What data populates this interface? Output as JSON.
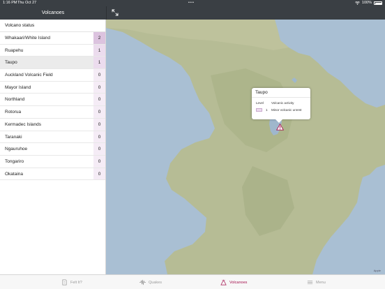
{
  "status_bar": {
    "time": "1:16 PM",
    "date": "Thu Oct 27",
    "dots": "•••",
    "battery": "100%"
  },
  "sidebar": {
    "title": "Volcanoes",
    "list_header": "Volcano status",
    "items": [
      {
        "name": "Whakaari/White Island",
        "level": "2"
      },
      {
        "name": "Ruapehu",
        "level": "1"
      },
      {
        "name": "Taupo",
        "level": "1"
      },
      {
        "name": "Auckland Volcanic Field",
        "level": "0"
      },
      {
        "name": "Mayor Island",
        "level": "0"
      },
      {
        "name": "Northland",
        "level": "0"
      },
      {
        "name": "Rotorua",
        "level": "0"
      },
      {
        "name": "Kermadec Islands",
        "level": "0"
      },
      {
        "name": "Taranaki",
        "level": "0"
      },
      {
        "name": "Ngauruhoe",
        "level": "0"
      },
      {
        "name": "Tongariro",
        "level": "0"
      },
      {
        "name": "Okataina",
        "level": "0"
      }
    ],
    "selected_index": 2,
    "level_colors": {
      "2": "#dcc3df",
      "1": "#ecdcee",
      "0": "#f5ecf6"
    }
  },
  "map": {
    "popup": {
      "title": "Taupo",
      "level_header": "Level",
      "activity_header": "Volcanic activity",
      "level": "1",
      "activity": "Minor volcanic unrest"
    },
    "attribution": "Apple",
    "colors": {
      "sea": "#a9bfd3",
      "land": "#b6bc95",
      "lake": "#9fb7cc"
    }
  },
  "tab_bar": {
    "accent": "#a5134f",
    "tabs": [
      {
        "label": "Felt It?",
        "icon": "pin-icon",
        "active": false
      },
      {
        "label": "Quakes",
        "icon": "waveform-icon",
        "active": false
      },
      {
        "label": "Volcanoes",
        "icon": "volcano-icon",
        "active": true
      },
      {
        "label": "Menu",
        "icon": "menu-icon",
        "active": false
      }
    ]
  }
}
